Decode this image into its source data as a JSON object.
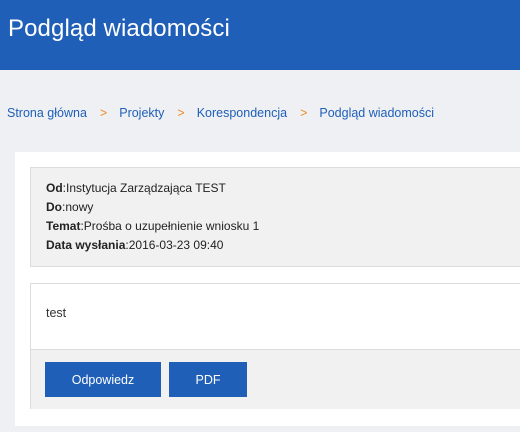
{
  "header": {
    "title": "Podgląd wiadomości"
  },
  "breadcrumb": {
    "items": [
      "Strona główna",
      "Projekty",
      "Korespondencja",
      "Podgląd wiadomości"
    ],
    "separator": ">"
  },
  "message": {
    "from_label": "Od",
    "from_value": "Instytucja Zarządzająca TEST",
    "to_label": "Do",
    "to_value": "nowy",
    "subject_label": "Temat",
    "subject_value": "Prośba o uzupełnienie wniosku 1",
    "sent_label": "Data wysłania",
    "sent_value": "2016-03-23 09:40",
    "body": "test"
  },
  "actions": {
    "reply_label": "Odpowiedz",
    "pdf_label": "PDF"
  },
  "colors": {
    "brand_blue": "#1f5fb8",
    "breadcrumb_separator": "#f08a24",
    "panel_gray": "#f1f1f1",
    "page_background": "#eef0f4"
  }
}
